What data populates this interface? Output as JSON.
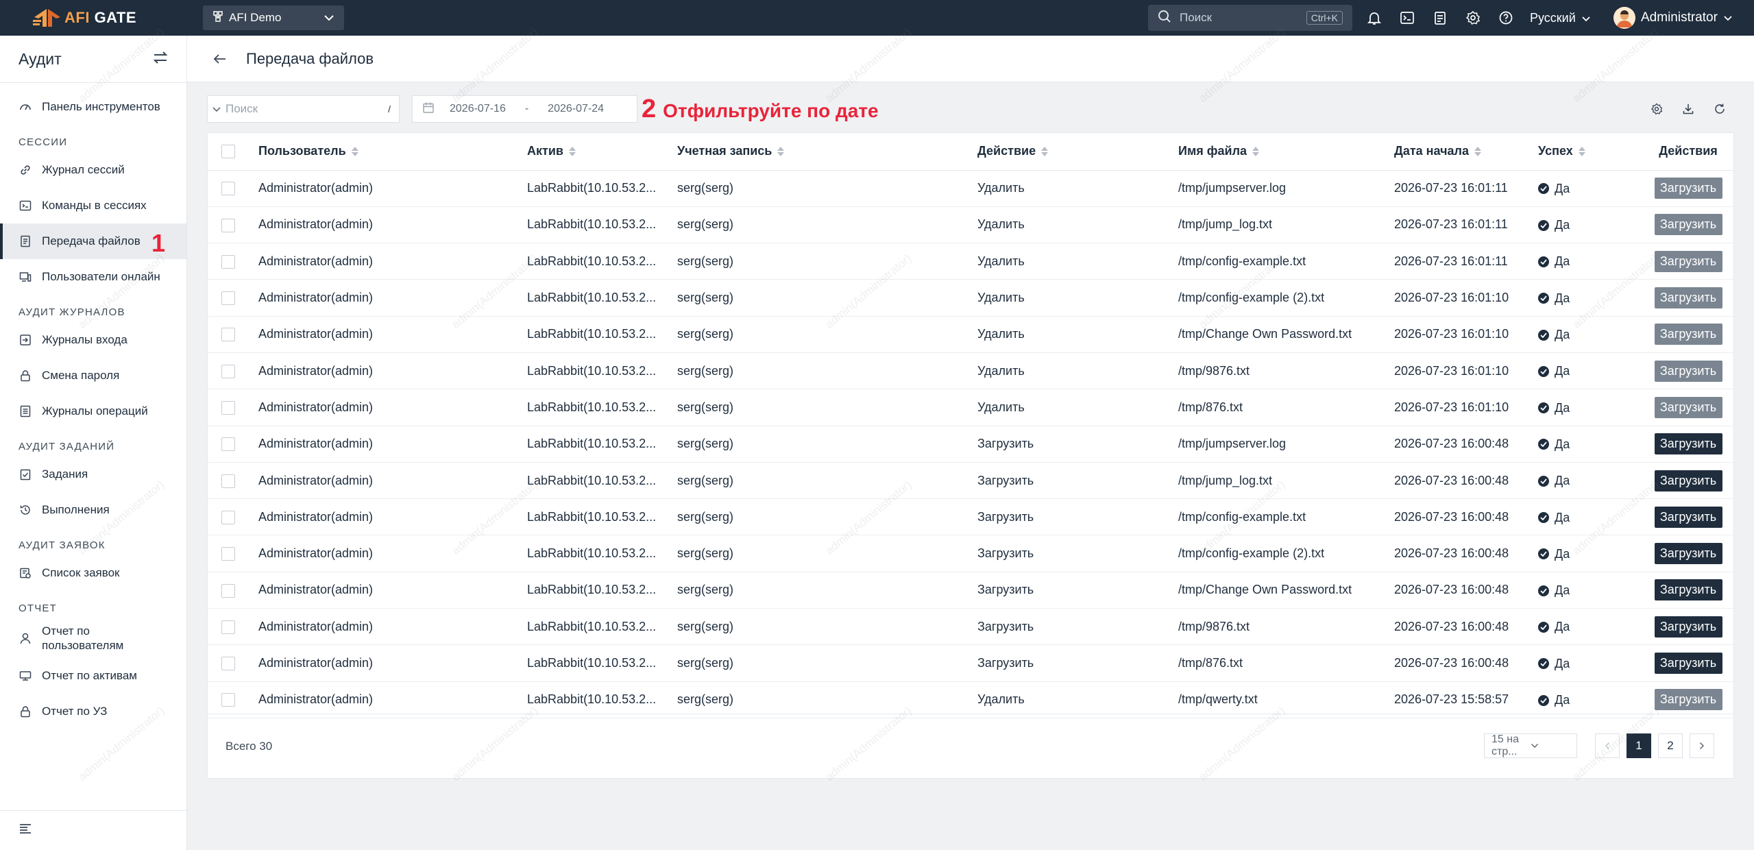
{
  "topbar": {
    "logo_afi": "AFI",
    "logo_gate": " GATE",
    "org": "AFI Demo",
    "search_placeholder": "Поиск",
    "search_shortcut": "Ctrl+K",
    "language": "Русский",
    "user_name": "Administrator"
  },
  "sidebar": {
    "title": "Аудит",
    "dashboard": "Панель инструментов",
    "sections": {
      "sessions": "СЕССИИ",
      "logs": "АУДИТ ЖУРНАЛОВ",
      "jobs": "АУДИТ ЗАДАНИЙ",
      "tickets": "АУДИТ ЗАЯВОК",
      "report": "ОТЧЕТ"
    },
    "items": {
      "session_log": "Журнал сессий",
      "session_commands": "Команды в сессиях",
      "file_transfer": "Передача файлов",
      "online_users": "Пользователи онлайн",
      "login_logs": "Журналы входа",
      "password_change": "Смена пароля",
      "operation_logs": "Журналы операций",
      "jobs": "Задания",
      "executions": "Выполнения",
      "ticket_list": "Список заявок",
      "user_report_1": "Отчет по",
      "user_report_2": "пользователям",
      "asset_report": "Отчет по активам",
      "account_report": "Отчет по УЗ"
    },
    "annotation": "1"
  },
  "page": {
    "title": "Передача файлов"
  },
  "filters": {
    "search_placeholder": "Поиск",
    "search_hint": "/",
    "date_from": "2026-07-16",
    "date_separator": "-",
    "date_to": "2026-07-24",
    "annotation_number": "2",
    "annotation_text": "Отфильтруйте по дате"
  },
  "table": {
    "columns": [
      "Пользователь",
      "Актив",
      "Учетная запись",
      "Действие",
      "Имя файла",
      "Дата начала",
      "Успех",
      "Действия"
    ],
    "success_text": "Да",
    "download_label": "Загрузить",
    "rows": [
      {
        "user": "Administrator(admin)",
        "asset": "LabRabbit(10.10.53.2...",
        "account": "serg(serg)",
        "action": "Удалить",
        "file": "/tmp/jumpserver.log",
        "date": "2026-07-23 16:01:11",
        "downloadable": false
      },
      {
        "user": "Administrator(admin)",
        "asset": "LabRabbit(10.10.53.2...",
        "account": "serg(serg)",
        "action": "Удалить",
        "file": "/tmp/jump_log.txt",
        "date": "2026-07-23 16:01:11",
        "downloadable": false
      },
      {
        "user": "Administrator(admin)",
        "asset": "LabRabbit(10.10.53.2...",
        "account": "serg(serg)",
        "action": "Удалить",
        "file": "/tmp/config-example.txt",
        "date": "2026-07-23 16:01:11",
        "downloadable": false
      },
      {
        "user": "Administrator(admin)",
        "asset": "LabRabbit(10.10.53.2...",
        "account": "serg(serg)",
        "action": "Удалить",
        "file": "/tmp/config-example (2).txt",
        "date": "2026-07-23 16:01:10",
        "downloadable": false
      },
      {
        "user": "Administrator(admin)",
        "asset": "LabRabbit(10.10.53.2...",
        "account": "serg(serg)",
        "action": "Удалить",
        "file": "/tmp/Change Own Password.txt",
        "date": "2026-07-23 16:01:10",
        "downloadable": false
      },
      {
        "user": "Administrator(admin)",
        "asset": "LabRabbit(10.10.53.2...",
        "account": "serg(serg)",
        "action": "Удалить",
        "file": "/tmp/9876.txt",
        "date": "2026-07-23 16:01:10",
        "downloadable": false
      },
      {
        "user": "Administrator(admin)",
        "asset": "LabRabbit(10.10.53.2...",
        "account": "serg(serg)",
        "action": "Удалить",
        "file": "/tmp/876.txt",
        "date": "2026-07-23 16:01:10",
        "downloadable": false
      },
      {
        "user": "Administrator(admin)",
        "asset": "LabRabbit(10.10.53.2...",
        "account": "serg(serg)",
        "action": "Загрузить",
        "file": "/tmp/jumpserver.log",
        "date": "2026-07-23 16:00:48",
        "downloadable": true
      },
      {
        "user": "Administrator(admin)",
        "asset": "LabRabbit(10.10.53.2...",
        "account": "serg(serg)",
        "action": "Загрузить",
        "file": "/tmp/jump_log.txt",
        "date": "2026-07-23 16:00:48",
        "downloadable": true
      },
      {
        "user": "Administrator(admin)",
        "asset": "LabRabbit(10.10.53.2...",
        "account": "serg(serg)",
        "action": "Загрузить",
        "file": "/tmp/config-example.txt",
        "date": "2026-07-23 16:00:48",
        "downloadable": true
      },
      {
        "user": "Administrator(admin)",
        "asset": "LabRabbit(10.10.53.2...",
        "account": "serg(serg)",
        "action": "Загрузить",
        "file": "/tmp/config-example (2).txt",
        "date": "2026-07-23 16:00:48",
        "downloadable": true
      },
      {
        "user": "Administrator(admin)",
        "asset": "LabRabbit(10.10.53.2...",
        "account": "serg(serg)",
        "action": "Загрузить",
        "file": "/tmp/Change Own Password.txt",
        "date": "2026-07-23 16:00:48",
        "downloadable": true
      },
      {
        "user": "Administrator(admin)",
        "asset": "LabRabbit(10.10.53.2...",
        "account": "serg(serg)",
        "action": "Загрузить",
        "file": "/tmp/9876.txt",
        "date": "2026-07-23 16:00:48",
        "downloadable": true
      },
      {
        "user": "Administrator(admin)",
        "asset": "LabRabbit(10.10.53.2...",
        "account": "serg(serg)",
        "action": "Загрузить",
        "file": "/tmp/876.txt",
        "date": "2026-07-23 16:00:48",
        "downloadable": true
      },
      {
        "user": "Administrator(admin)",
        "asset": "LabRabbit(10.10.53.2...",
        "account": "serg(serg)",
        "action": "Удалить",
        "file": "/tmp/qwerty.txt",
        "date": "2026-07-23 15:58:57",
        "downloadable": false
      }
    ]
  },
  "pagination": {
    "total": "Всего 30",
    "page_size": "15 на стр...",
    "pages": [
      "1",
      "2"
    ],
    "current_page": "1"
  },
  "watermark": "admin(Administrator)",
  "colors": {
    "topbar": "#1f2d3d",
    "accent": "#1f2d3d",
    "annotation": "#e8243a",
    "logo": "#f4a04a",
    "disabled_button": "#7a8591"
  }
}
